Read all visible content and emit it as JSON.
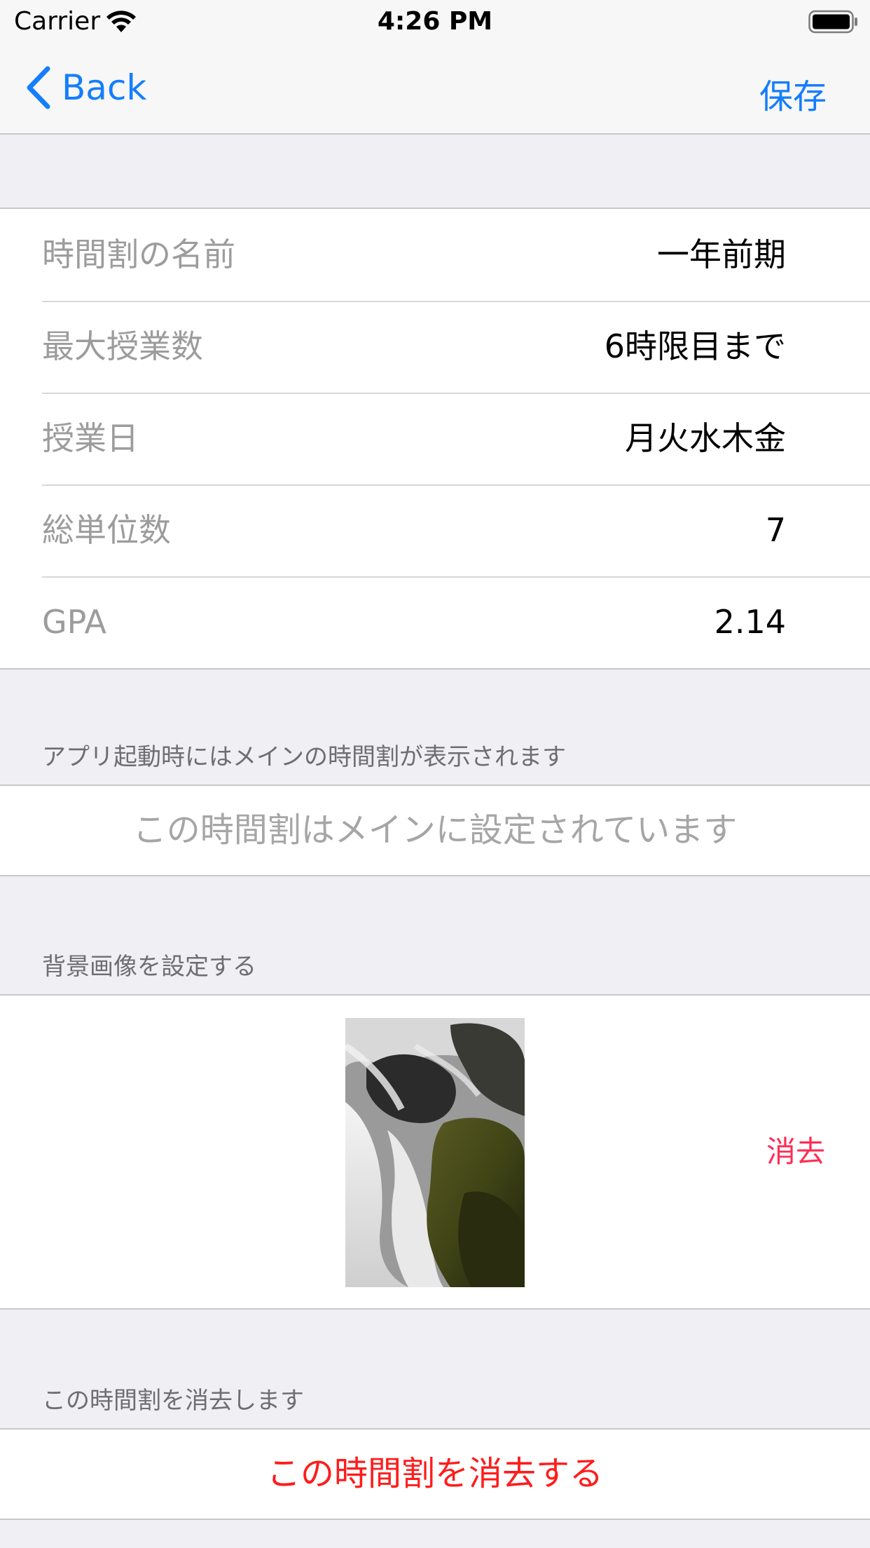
{
  "status_bar": {
    "carrier": "Carrier",
    "time": "4:26 PM"
  },
  "nav": {
    "back_label": "Back",
    "save_label": "保存"
  },
  "info": {
    "rows": [
      {
        "key": "時間割の名前",
        "value": "一年前期"
      },
      {
        "key": "最大授業数",
        "value": "6時限目まで"
      },
      {
        "key": "授業日",
        "value": "月火水木金"
      },
      {
        "key": "総単位数",
        "value": "7"
      },
      {
        "key": "GPA",
        "value": "2.14"
      }
    ]
  },
  "main_section": {
    "header": "アプリ起動時にはメインの時間割が表示されます",
    "status": "この時間割はメインに設定されています"
  },
  "background_section": {
    "header": "背景画像を設定する",
    "erase_label": "消去"
  },
  "delete_section": {
    "header": "この時間割を消去します",
    "button_label": "この時間割を消去する"
  },
  "colors": {
    "accent": "#147efb",
    "danger": "#ff1c1c",
    "erase": "#ff2d55",
    "background": "#efeff4"
  }
}
